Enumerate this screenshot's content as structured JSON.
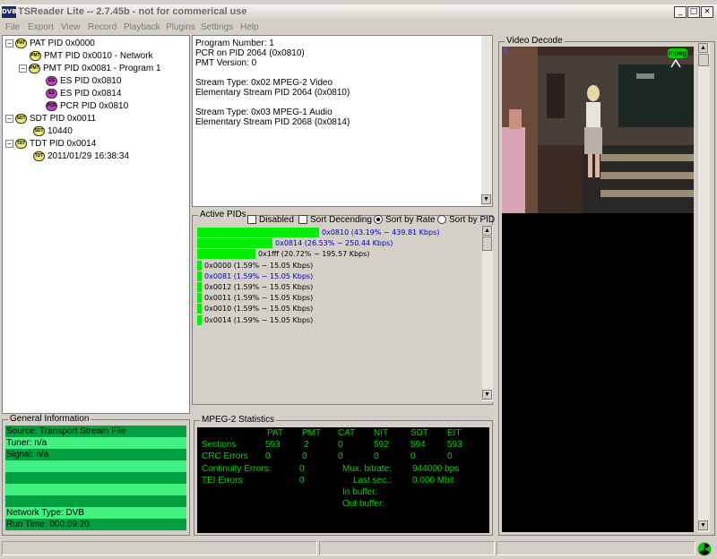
{
  "window": {
    "logo": "DVB",
    "title": "TSReader Lite -- 2.7.45b - not for commerical use",
    "min": "_",
    "max": "□",
    "close": "×"
  },
  "menu": [
    "File",
    "Export",
    "View",
    "Record",
    "Playback",
    "Plugins",
    "Settings",
    "Help"
  ],
  "tree": [
    {
      "label": "PAT PID 0x0000",
      "icon": "PAT",
      "level": 0,
      "expander": "−"
    },
    {
      "label": "PMT PID 0x0010 - Network",
      "icon": "PMT",
      "level": 1,
      "expander": ""
    },
    {
      "label": "PMT PID 0x0081 - Program 1",
      "icon": "PMT",
      "level": 1,
      "expander": "−"
    },
    {
      "label": "ES PID 0x0810",
      "icon": "ES",
      "level": 2,
      "expander": ""
    },
    {
      "label": "ES PID 0x0814",
      "icon": "ES",
      "level": 2,
      "expander": ""
    },
    {
      "label": "PCR PID 0x0810",
      "icon": "PCR",
      "level": 2,
      "expander": ""
    },
    {
      "label": "SDT PID 0x0011",
      "icon": "SDT",
      "level": 0,
      "expander": "−"
    },
    {
      "label": "10440",
      "icon": "SDT",
      "level": 1,
      "expander": ""
    },
    {
      "label": "TDT PID 0x0014",
      "icon": "TDT",
      "level": 0,
      "expander": "−"
    },
    {
      "label": "2011/01/29 16:38:34",
      "icon": "TDT",
      "level": 1,
      "expander": ""
    }
  ],
  "program_info": [
    "Program Number: 1",
    "PCR on PID 2064 (0x0810)",
    "PMT Version: 0",
    "",
    "Stream Type: 0x02 MPEG-2 Video",
    " Elementary Stream PID 2064 (0x0810)",
    "",
    "Stream Type: 0x03 MPEG-1 Audio",
    " Elementary Stream PID 2068 (0x0814)"
  ],
  "active_pids": {
    "label": "Active PIDs",
    "options": {
      "disabled": "Disabled",
      "sort_descending": "Sort Decending",
      "sort_by_rate": "Sort by Rate",
      "sort_by_pid": "Sort by PID"
    },
    "rows": [
      {
        "text": "0x0810 (43.19% ~ 439.81 Kbps)",
        "fill": 0.4319,
        "color": "#0000c0"
      },
      {
        "text": "0x0814 (26.53% ~ 250.44 Kbps)",
        "fill": 0.2653,
        "color": "#0000c0"
      },
      {
        "text": "0x1fff (20.72% ~ 195.57 Kbps)",
        "fill": 0.2072,
        "color": "#000000"
      },
      {
        "text": "0x0000 (1.59% ~ 15.05 Kbps)",
        "fill": 0.0159,
        "color": "#000000"
      },
      {
        "text": "0x0081 (1.59% ~ 15.05 Kbps)",
        "fill": 0.0159,
        "color": "#0000c0"
      },
      {
        "text": "0x0012 (1.59% ~ 15.05 Kbps)",
        "fill": 0.0159,
        "color": "#000000"
      },
      {
        "text": "0x0011 (1.59% ~ 15.05 Kbps)",
        "fill": 0.0159,
        "color": "#000000"
      },
      {
        "text": "0x0010 (1.59% ~ 15.05 Kbps)",
        "fill": 0.0159,
        "color": "#000000"
      },
      {
        "text": "0x0014 (1.59% ~ 15.05 Kbps)",
        "fill": 0.0159,
        "color": "#000000"
      }
    ]
  },
  "video": {
    "label": "Video Decode",
    "badge": "mpeg",
    "corner_digit": "1"
  },
  "general_info": {
    "label": "General Information",
    "rows": [
      "Source: Transport Stream File",
      "Tuner: n/a",
      "Signal: n/a",
      "",
      "",
      "",
      "",
      "Network Type: DVB",
      "Run Time: 000:09:20"
    ]
  },
  "mpeg2_stats": {
    "label": "MPEG-2 Statistics",
    "headers": [
      "PAT",
      "PMT",
      "CAT",
      "NIT",
      "SDT",
      "EIT"
    ],
    "sections_label": "Sections",
    "sections": [
      "593",
      "2",
      "0",
      "592",
      "594",
      "593"
    ],
    "crc_label": "CRC Errors",
    "crc": [
      "0",
      "0",
      "0",
      "0",
      "0",
      "0"
    ],
    "continuity_label": "Continuity Errors:",
    "continuity": "0",
    "tei_label": "TEI Errors:",
    "tei": "0",
    "mux_label": "Mux. bitrate:",
    "mux": "944000 bps",
    "last_label": "Last sec.:",
    "last": "0.000 Mbit",
    "inbuf_label": "In buffer:",
    "outbuf_label": "Out buffer:"
  },
  "colors": {
    "bar_green": "#00ee00",
    "stats_green": "#00d000",
    "info_dark": "#00a040",
    "info_light": "#40f080"
  }
}
